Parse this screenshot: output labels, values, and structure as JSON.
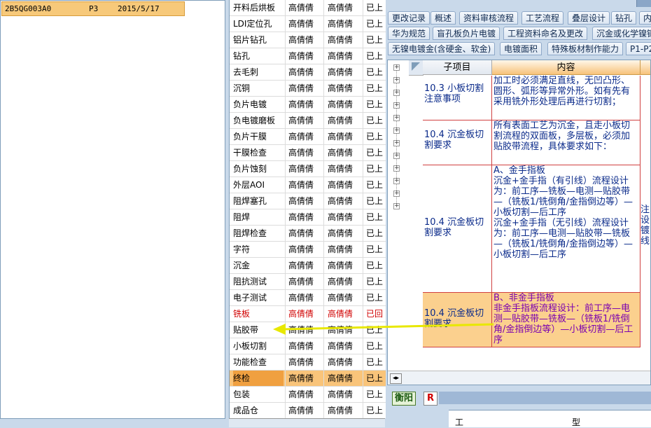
{
  "left_list": {
    "rows": [
      {
        "code": "2B5QG003A0",
        "level": "P3",
        "date": "2015/5/17"
      }
    ]
  },
  "process_table": {
    "rows": [
      {
        "step": "开料后烘板",
        "person1": "高倩倩",
        "person2": "高倩倩",
        "status": "已上"
      },
      {
        "step": "LDI定位孔",
        "person1": "高倩倩",
        "person2": "高倩倩",
        "status": "已上"
      },
      {
        "step": "铝片钻孔",
        "person1": "高倩倩",
        "person2": "高倩倩",
        "status": "已上"
      },
      {
        "step": "钻孔",
        "person1": "高倩倩",
        "person2": "高倩倩",
        "status": "已上"
      },
      {
        "step": "去毛刺",
        "person1": "高倩倩",
        "person2": "高倩倩",
        "status": "已上"
      },
      {
        "step": "沉铜",
        "person1": "高倩倩",
        "person2": "高倩倩",
        "status": "已上"
      },
      {
        "step": "负片电镀",
        "person1": "高倩倩",
        "person2": "高倩倩",
        "status": "已上"
      },
      {
        "step": "负电镀磨板",
        "person1": "高倩倩",
        "person2": "高倩倩",
        "status": "已上"
      },
      {
        "step": "负片干膜",
        "person1": "高倩倩",
        "person2": "高倩倩",
        "status": "已上"
      },
      {
        "step": "干膜检查",
        "person1": "高倩倩",
        "person2": "高倩倩",
        "status": "已上"
      },
      {
        "step": "负片蚀刻",
        "person1": "高倩倩",
        "person2": "高倩倩",
        "status": "已上"
      },
      {
        "step": "外层AOI",
        "person1": "高倩倩",
        "person2": "高倩倩",
        "status": "已上"
      },
      {
        "step": "阻焊塞孔",
        "person1": "高倩倩",
        "person2": "高倩倩",
        "status": "已上"
      },
      {
        "step": "阻焊",
        "person1": "高倩倩",
        "person2": "高倩倩",
        "status": "已上"
      },
      {
        "step": "阻焊检查",
        "person1": "高倩倩",
        "person2": "高倩倩",
        "status": "已上"
      },
      {
        "step": "字符",
        "person1": "高倩倩",
        "person2": "高倩倩",
        "status": "已上"
      },
      {
        "step": "沉金",
        "person1": "高倩倩",
        "person2": "高倩倩",
        "status": "已上"
      },
      {
        "step": "阻抗测试",
        "person1": "高倩倩",
        "person2": "高倩倩",
        "status": "已上"
      },
      {
        "step": "电子测试",
        "person1": "高倩倩",
        "person2": "高倩倩",
        "status": "已上"
      },
      {
        "step": "铣板",
        "person1": "高倩倩",
        "person2": "高倩倩",
        "status": "已回"
      },
      {
        "step": "贴胶带",
        "person1": "高倩倩",
        "person2": "高倩倩",
        "status": "已上"
      },
      {
        "step": "小板切割",
        "person1": "高倩倩",
        "person2": "高倩倩",
        "status": "已上"
      },
      {
        "step": "功能检查",
        "person1": "高倩倩",
        "person2": "高倩倩",
        "status": "已上"
      },
      {
        "step": "终检",
        "person1": "高倩倩",
        "person2": "高倩倩",
        "status": "已上"
      },
      {
        "step": "包装",
        "person1": "高倩倩",
        "person2": "高倩倩",
        "status": "已上"
      },
      {
        "step": "成品仓",
        "person1": "高倩倩",
        "person2": "高倩倩",
        "status": "已上"
      }
    ],
    "highlight_color": "#f9c47a",
    "alert_color": "#d00000"
  },
  "tabs": {
    "row1": [
      "更改记录",
      "概述",
      "资料审核流程",
      "工艺流程",
      "叠层设计",
      "钻孔",
      "内"
    ],
    "row2": [
      "华为规范",
      "盲孔板负片电镀",
      "工程资料命名及更改",
      "沉金或化学镍钯"
    ],
    "row3": [
      "无镍电镀金(含硬金、软金)",
      "电镀面积",
      "特殊板材制作能力",
      "P1-P2"
    ]
  },
  "detail_grid": {
    "header_sub": "子项目",
    "header_content": "内容",
    "rows": [
      {
        "item": "10.3 小板切割注意事项",
        "content": "加工时必须满足直线，无凹凸形、圆形、弧形等异常外形。如有先有采用铣外形处理后再进行切割；",
        "extra": ""
      },
      {
        "item": "10.4 沉金板切割要求",
        "content": "所有表面工艺为沉金，且走小板切割流程的双面板，多层板，必须加贴胶带流程，具体要求如下：",
        "extra": ""
      },
      {
        "item": "10.4 沉金板切割要求",
        "content": "A、金手指板\n沉金+金手指（有引线）流程设计为：前工序—铣板—电测—贴胶带—（铣板1/铣倒角/金指倒边等）—小板切割—后工序\n沉金+金手指（无引线）流程设计为：前工序—电测—贴胶带—铣板—（铣板1/铣倒角/金指倒边等）—小板切割—后工序",
        "extra": "注设镀线"
      },
      {
        "item": "10.4 沉金板切割要求",
        "content": "B、非金手指板\n非金手指板流程设计：前工序—电测—贴胶带—铣板—（铣板1/铣倒角/金指倒边等）—小板切割—后工序",
        "extra": ""
      }
    ],
    "accent_color": "#f7c27a",
    "selected_text_color": "#7a00b0"
  },
  "status": {
    "city": "衡阳",
    "badge": "R"
  },
  "lower_panel": {
    "label1": "工",
    "label2": "型"
  },
  "annotation": {
    "arrow_color": "#e8e800"
  }
}
